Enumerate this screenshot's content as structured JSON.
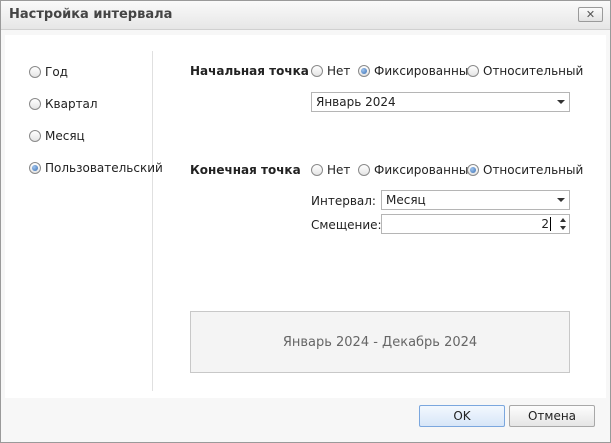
{
  "window": {
    "title": "Настройка интервала",
    "close_glyph": "✕"
  },
  "period_options": [
    {
      "label": "Год",
      "selected": false
    },
    {
      "label": "Квартал",
      "selected": false
    },
    {
      "label": "Месяц",
      "selected": false
    },
    {
      "label": "Пользовательский",
      "selected": true
    }
  ],
  "start_point": {
    "label": "Начальная точка",
    "options": [
      {
        "label": "Нет",
        "selected": false
      },
      {
        "label": "Фиксированный",
        "selected": true
      },
      {
        "label": "Относительный",
        "selected": false
      }
    ],
    "date_value": "Январь 2024"
  },
  "end_point": {
    "label": "Конечная точка",
    "options": [
      {
        "label": "Нет",
        "selected": false
      },
      {
        "label": "Фиксированный",
        "selected": false
      },
      {
        "label": "Относительный",
        "selected": true
      }
    ],
    "interval_label": "Интервал:",
    "interval_value": "Месяц",
    "offset_label": "Смещение:",
    "offset_value": "2"
  },
  "preview_text": "Январь 2024 - Декабрь 2024",
  "buttons": {
    "ok": "OK",
    "cancel": "Отмена"
  },
  "colors": {
    "radio_selected": "#3a6fb3",
    "ok_button_border": "#7ba7de"
  }
}
